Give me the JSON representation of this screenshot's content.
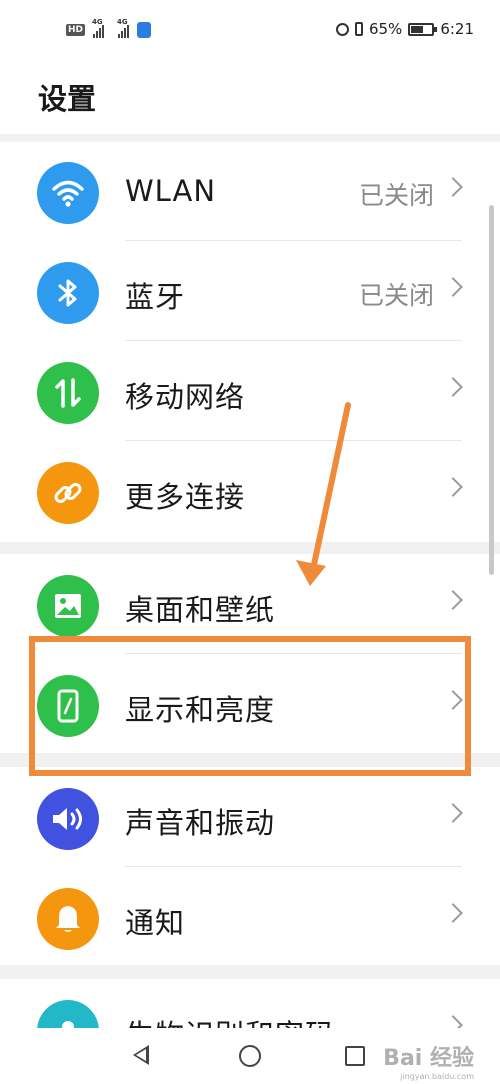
{
  "status_bar": {
    "hd_badge": "HD",
    "sim1_tech": "4G",
    "sim2_tech": "4G",
    "battery_percent": "65%",
    "battery_level": 0.65,
    "time": "6:21"
  },
  "page_title": "设置",
  "groups": [
    {
      "items": [
        {
          "label": "WLAN",
          "status": "已关闭",
          "icon": "wifi-icon",
          "color": "#2e9bef"
        },
        {
          "label": "蓝牙",
          "status": "已关闭",
          "icon": "bluetooth-icon",
          "color": "#2e9bef"
        },
        {
          "label": "移动网络",
          "status": "",
          "icon": "mobile-data-icon",
          "color": "#2fbf4b"
        },
        {
          "label": "更多连接",
          "status": "",
          "icon": "link-icon",
          "color": "#f5960f"
        }
      ]
    },
    {
      "items": [
        {
          "label": "桌面和壁纸",
          "status": "",
          "icon": "wallpaper-icon",
          "color": "#2fbf4b"
        },
        {
          "label": "显示和亮度",
          "status": "",
          "icon": "display-icon",
          "color": "#2fbf4b"
        }
      ]
    },
    {
      "items": [
        {
          "label": "声音和振动",
          "status": "",
          "icon": "sound-icon",
          "color": "#4152e0"
        },
        {
          "label": "通知",
          "status": "",
          "icon": "notification-bell-icon",
          "color": "#f5960f"
        }
      ]
    },
    {
      "items": [
        {
          "label": "生物识别和密码",
          "status": "",
          "icon": "biometric-icon",
          "color": "#22b8c8"
        }
      ]
    }
  ],
  "annotation_color": "#ef8a3a",
  "watermark": {
    "text": "Bai 经验",
    "sub": "jingyan.baidu.com"
  }
}
